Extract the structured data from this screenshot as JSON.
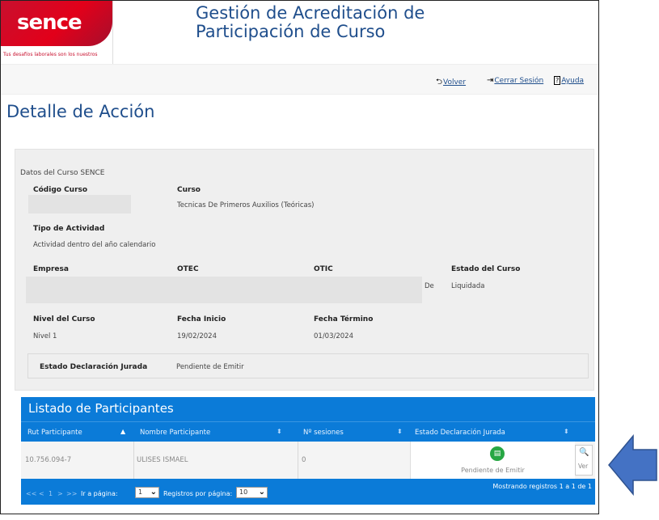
{
  "brand": {
    "logo_text": "sencе",
    "tagline": "Tus desafíos laborales son los nuestros"
  },
  "header": {
    "title_line1": "Gestión de Acreditación de",
    "title_line2": "Participación de Curso"
  },
  "toolbar": {
    "volver": "Volver",
    "cerrar_sesion": "Cerrar Sesión",
    "ayuda": "Ayuda"
  },
  "page": {
    "title": "Detalle de Acción"
  },
  "course": {
    "section_title": "Datos del Curso SENCE",
    "codigo_label": "Código Curso",
    "codigo_value": "",
    "curso_label": "Curso",
    "curso_value": "Tecnicas De Primeros Auxilios (Teóricas)",
    "tipo_label": "Tipo de Actividad",
    "tipo_value": "Actividad dentro del año calendario",
    "empresa_label": "Empresa",
    "otec_label": "OTEC",
    "otic_label": "OTIC",
    "otic_value_suffix": "De",
    "estado_label": "Estado del Curso",
    "estado_value": "Liquidada",
    "nivel_label": "Nivel del Curso",
    "nivel_value": "Nivel 1",
    "inicio_label": "Fecha Inicio",
    "inicio_value": "19/02/2024",
    "termino_label": "Fecha Término",
    "termino_value": "01/03/2024",
    "dj_label": "Estado Declaración Jurada",
    "dj_value": "Pendiente de Emitir"
  },
  "participants": {
    "title": "Listado de Participantes",
    "columns": [
      "Rut Participante",
      "Nombre Participante",
      "Nº sesiones",
      "Estado Declaración Jurada"
    ],
    "rows": [
      {
        "rut": "10.756.094-7",
        "nombre": "ULISES ISMAEL",
        "sesiones": "0",
        "estado": "Pendiente de Emitir",
        "accion": "Ver"
      }
    ],
    "pager": {
      "first": "<<",
      "prev": "<",
      "current": "1",
      "next": ">",
      "last": ">>",
      "ir_label": "Ir a página:",
      "page_select": "1",
      "registros_label": "Registros por página:",
      "per_page_select": "10",
      "info": "Mostrando registros 1 a 1 de 1"
    }
  },
  "colors": {
    "brand_red": "#e2001a",
    "title_blue": "#1f4e8c",
    "grid_blue": "#0b7bd8",
    "status_green": "#27a744",
    "arrow_blue": "#4472c4"
  }
}
